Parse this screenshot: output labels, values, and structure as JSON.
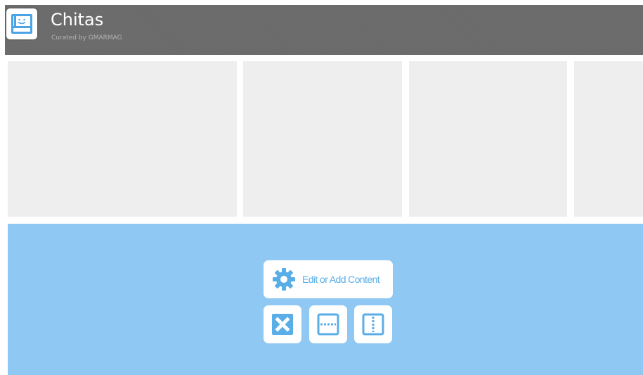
{
  "header": {
    "title": "Chitas",
    "subtitle": "Curated by GMARMAG",
    "logo_icon": "face-board-icon",
    "background_color": "#6a6a6a"
  },
  "tiles": [
    {
      "name": "content-tile-1"
    },
    {
      "name": "content-tile-2"
    },
    {
      "name": "content-tile-3"
    },
    {
      "name": "content-tile-4"
    }
  ],
  "edit_panel": {
    "background_color": "#8ec8f3",
    "accent_color": "#5aaee8",
    "edit_button": {
      "label": "Edit or Add Content",
      "icon": "gear-icon"
    },
    "tool_buttons": [
      {
        "icon": "remove-x-icon",
        "action": "remove"
      },
      {
        "icon": "split-horizontal-icon",
        "action": "split-horizontal"
      },
      {
        "icon": "split-vertical-icon",
        "action": "split-vertical"
      }
    ]
  }
}
